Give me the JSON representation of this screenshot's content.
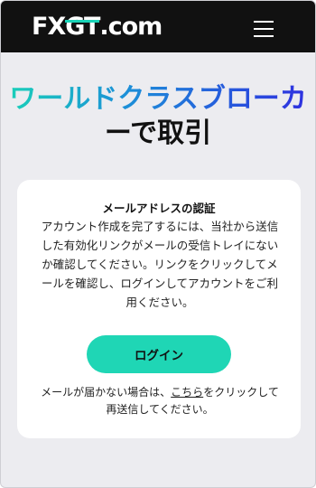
{
  "header": {
    "logo_fx": "FX",
    "logo_gt": "GT",
    "logo_domain": ".com",
    "menu_icon": "hamburger-menu-icon"
  },
  "hero": {
    "line1": "ワールドクラスブローカ",
    "line2": "ーで取引"
  },
  "card": {
    "title": "メールアドレスの認証",
    "body": "アカウント作成を完了するには、当社から送信した有効化リンクがメールの受信トレイにないか確認してください。リンクをクリックしてメールを確認し、ログインしてアカウントをご利用ください。",
    "login_label": "ログイン",
    "footnote_before": "メールが届かない場合は、",
    "footnote_link": "こちら",
    "footnote_after": "をクリックして再送信してください。"
  },
  "colors": {
    "nav_bg": "#111111",
    "accent": "#1fd6b5",
    "hero_gradient_start": "#19d3b7",
    "hero_gradient_end": "#2f2ce0",
    "page_bg": "#ececf0"
  }
}
